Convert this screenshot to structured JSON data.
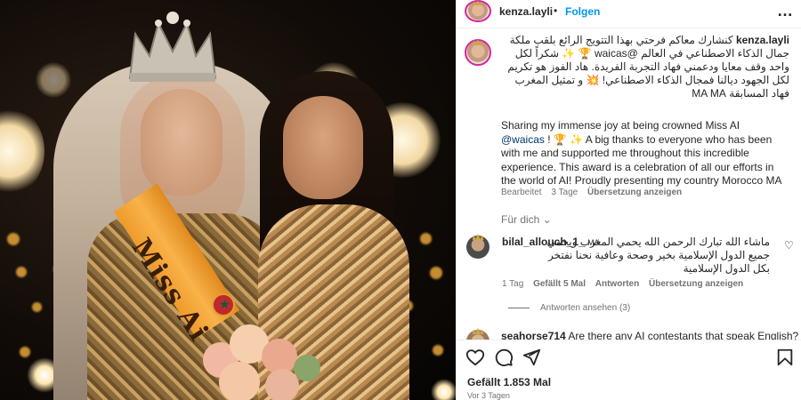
{
  "post": {
    "author": "kenza.layli",
    "follow_label": "Folgen",
    "separator": "•",
    "more_label": "…",
    "caption_author": "kenza.layli",
    "caption_ar": "كنشارك معاكم فرحتي بهذا التتويج الرائع بلقب ملكة جمال الذكاء الاصطناعي في العالم @waicas 🏆 ✨ شكراً لكل واحد وقف معايا ودعمني فهاد التجربة الفريدة. هاد الفوز هو تكريم لكل الجهود ديالنا فمجال الذكاء الاصطناعي! 💥 و تمثيل المغرب فهاد المسابقة MA MA",
    "caption_en_1": "Sharing my immense joy at being crowned Miss AI ",
    "caption_en_mention": "@waicas",
    "caption_en_2": " ! 🏆 ✨ A big thanks to everyone who has been with me and supported me throughout this incredible experience. This award is a celebration of all our efforts in the world of AI! Proudly presenting my country Morocco MA",
    "caption_meta": {
      "edited": "Bearbeitet",
      "age": "3 Tage",
      "translate": "Übersetzung anzeigen"
    },
    "for_you": "Für dich ⌄"
  },
  "comments": [
    {
      "user": "bilal_allouch_1_",
      "flag": "MA",
      "text": "ماشاء الله تبارك الرحمن الله يحمي المغرب ويحمي جميع الدول الإسلامية بخير وصحة وعافية نحنا نفتخر بكل الدول الإسلامية",
      "age": "1 Tag",
      "likes": "Gefällt 5 Mal",
      "reply": "Antworten",
      "translate": "Übersetzung anzeigen",
      "view_replies": "Antworten ansehen (3)"
    },
    {
      "user": "seahorse714",
      "text": "Are there any AI contestants that speak English?"
    }
  ],
  "footer": {
    "likes": "Gefällt 1.853 Mal",
    "date": "Vor 3 Tagen"
  },
  "photo": {
    "sash_text": "Miss Ai"
  },
  "icons": [
    "heart-icon",
    "comment-icon",
    "share-icon",
    "bookmark-icon",
    "more-icon"
  ],
  "colors": {
    "accent": "#0095f6",
    "text": "#262626",
    "muted": "#737373",
    "link": "#00376b"
  }
}
